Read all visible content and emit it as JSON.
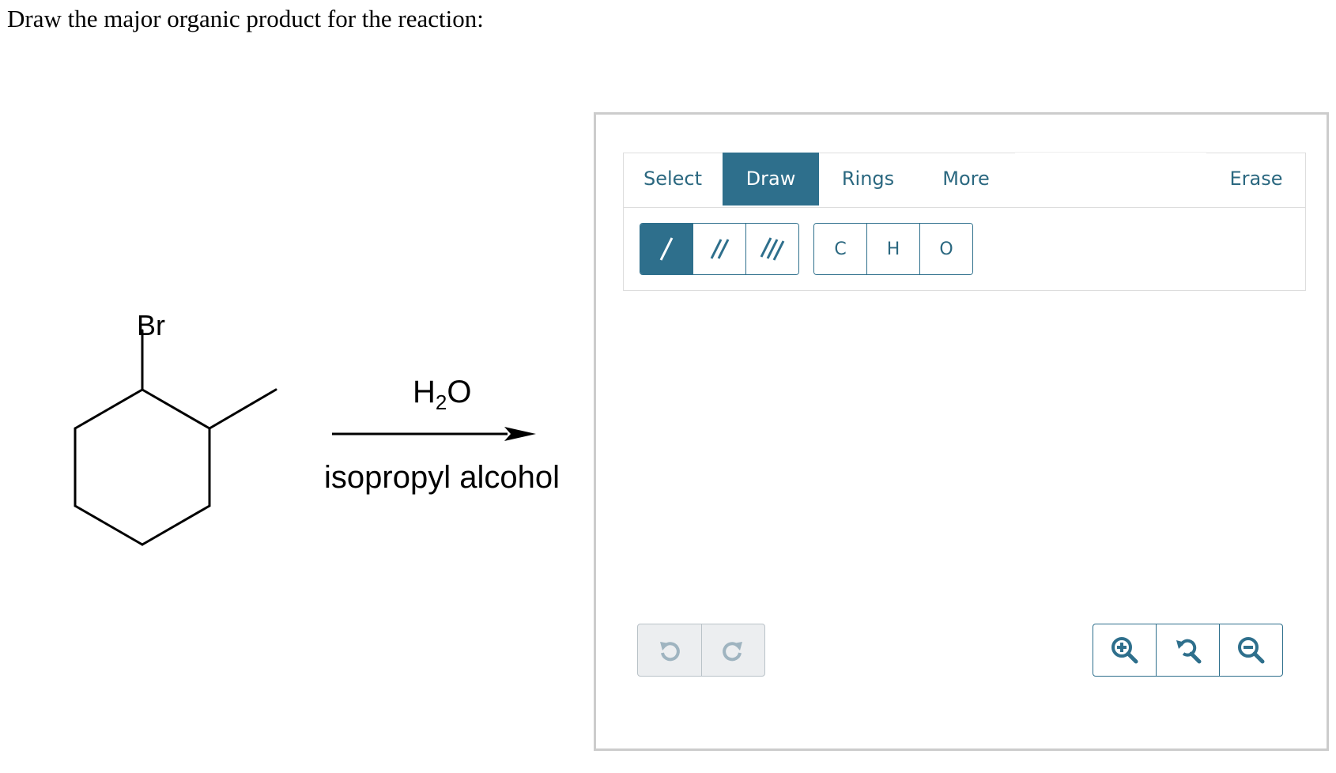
{
  "question": {
    "text": "Draw the major organic product for the reaction:"
  },
  "reaction": {
    "substituent_label": "Br",
    "reagent_top_main": "H",
    "reagent_top_sub": "2",
    "reagent_top_tail": "O",
    "reagent_bottom": "isopropyl alcohol"
  },
  "widget": {
    "tabs": {
      "select": "Select",
      "draw": "Draw",
      "rings": "Rings",
      "more": "More",
      "erase": "Erase"
    },
    "active_tab": "Draw",
    "bond_buttons": [
      "single-bond",
      "double-bond",
      "triple-bond"
    ],
    "atom_buttons": [
      "C",
      "H",
      "O"
    ],
    "undo_icons": [
      "undo-icon",
      "redo-icon"
    ],
    "zoom_icons": [
      "zoom-in-icon",
      "zoom-reset-icon",
      "zoom-out-icon"
    ]
  },
  "colors": {
    "accent": "#2e6f8c",
    "tab_text": "#2b6880",
    "disabled_icon": "#9fb4c0",
    "border": "#cccccc"
  }
}
